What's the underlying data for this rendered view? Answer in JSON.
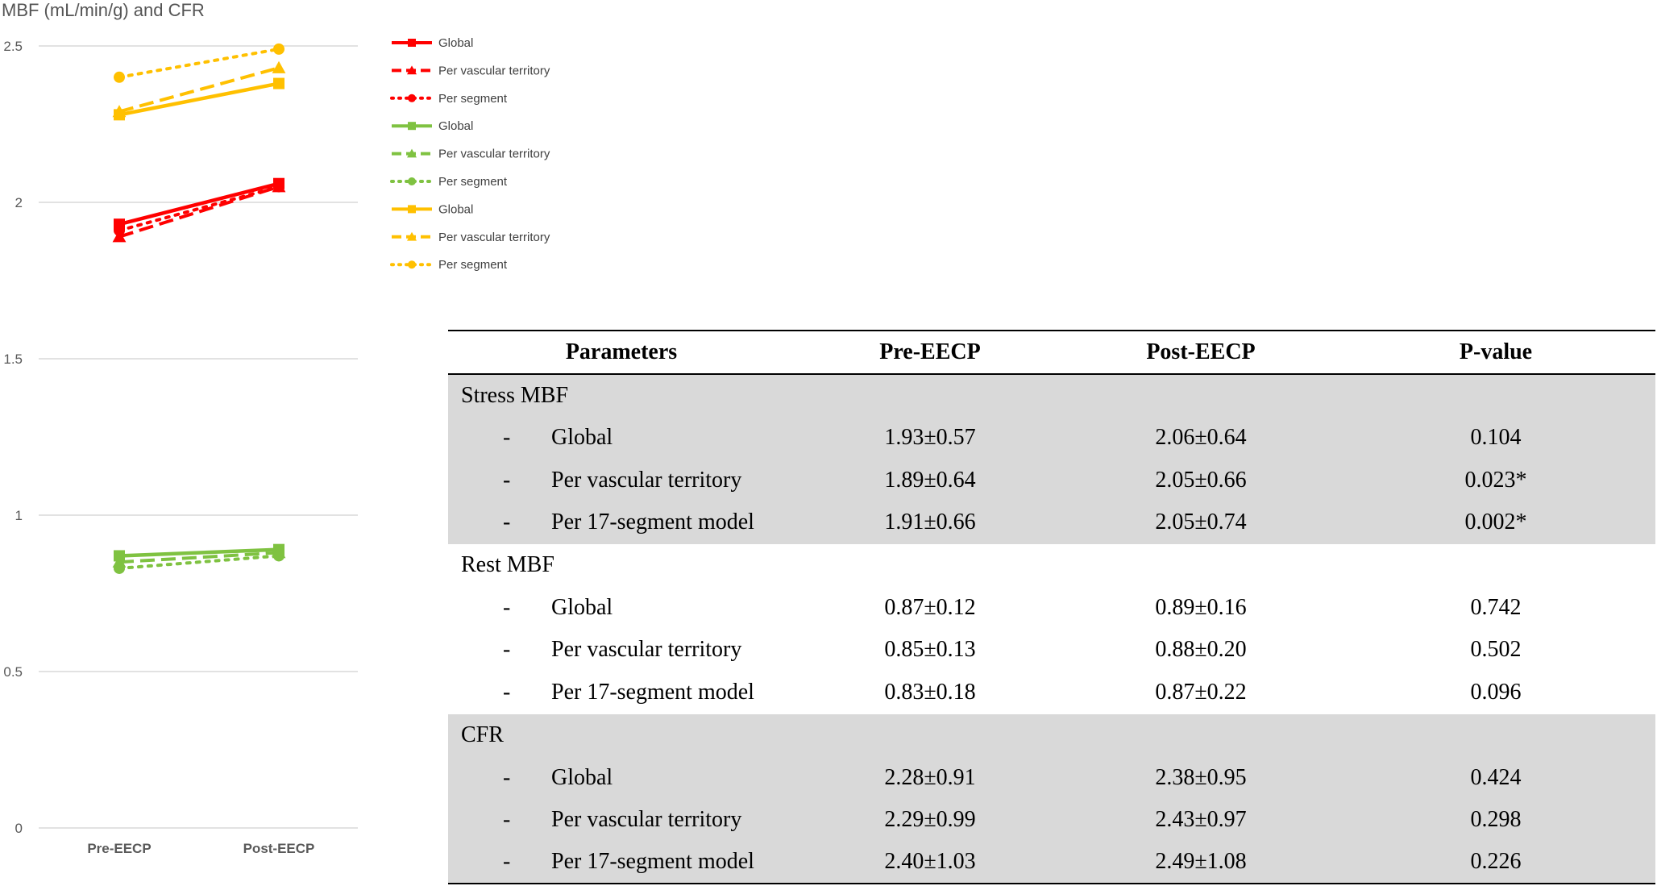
{
  "chart_data": {
    "type": "line",
    "title": "MBF (mL/min/g) and CFR",
    "categories": [
      "Pre-EECP",
      "Post-EECP"
    ],
    "ylim": [
      0,
      2.5
    ],
    "yticks": [
      "0",
      "0.5",
      "1",
      "1.5",
      "2",
      "2.5"
    ],
    "grid": true,
    "legend_position": "right",
    "series": [
      {
        "name": "Global",
        "values": [
          1.93,
          2.06
        ],
        "color": "#ff0000",
        "dash": "solid",
        "marker": "square"
      },
      {
        "name": "Per vascular territory",
        "values": [
          1.89,
          2.05
        ],
        "color": "#ff0000",
        "dash": "dashed",
        "marker": "triangle"
      },
      {
        "name": "Per segment",
        "values": [
          1.91,
          2.05
        ],
        "color": "#ff0000",
        "dash": "dotted",
        "marker": "circle"
      },
      {
        "name": "Global",
        "values": [
          0.87,
          0.89
        ],
        "color": "#7fc241",
        "dash": "solid",
        "marker": "square"
      },
      {
        "name": "Per vascular territory",
        "values": [
          0.85,
          0.88
        ],
        "color": "#7fc241",
        "dash": "dashed",
        "marker": "triangle"
      },
      {
        "name": "Per segment",
        "values": [
          0.83,
          0.87
        ],
        "color": "#7fc241",
        "dash": "dotted",
        "marker": "circle"
      },
      {
        "name": "Global",
        "values": [
          2.28,
          2.38
        ],
        "color": "#ffc000",
        "dash": "solid",
        "marker": "square"
      },
      {
        "name": "Per vascular territory",
        "values": [
          2.29,
          2.43
        ],
        "color": "#ffc000",
        "dash": "dashed",
        "marker": "triangle"
      },
      {
        "name": "Per segment",
        "values": [
          2.4,
          2.49
        ],
        "color": "#ffc000",
        "dash": "dotted",
        "marker": "circle"
      }
    ]
  },
  "table": {
    "headers": [
      "Parameters",
      "Pre-EECP",
      "Post-EECP",
      "P-value"
    ],
    "rows": [
      {
        "kind": "group",
        "shade": true,
        "label": "Stress MBF",
        "pre": "",
        "post": "",
        "p": ""
      },
      {
        "kind": "item",
        "shade": true,
        "dash": "-",
        "label": "Global",
        "pre": "1.93±0.57",
        "post": "2.06±0.64",
        "p": "0.104"
      },
      {
        "kind": "item",
        "shade": true,
        "dash": "-",
        "label": "Per vascular territory",
        "pre": "1.89±0.64",
        "post": "2.05±0.66",
        "p": "0.023*"
      },
      {
        "kind": "item",
        "shade": true,
        "dash": "-",
        "label": "Per 17-segment model",
        "pre": "1.91±0.66",
        "post": "2.05±0.74",
        "p": "0.002*"
      },
      {
        "kind": "group",
        "shade": false,
        "label": "Rest MBF",
        "pre": "",
        "post": "",
        "p": ""
      },
      {
        "kind": "item",
        "shade": false,
        "dash": "-",
        "label": "Global",
        "pre": "0.87±0.12",
        "post": "0.89±0.16",
        "p": "0.742"
      },
      {
        "kind": "item",
        "shade": false,
        "dash": "-",
        "label": "Per vascular territory",
        "pre": "0.85±0.13",
        "post": "0.88±0.20",
        "p": "0.502"
      },
      {
        "kind": "item",
        "shade": false,
        "dash": "-",
        "label": "Per 17-segment model",
        "pre": "0.83±0.18",
        "post": "0.87±0.22",
        "p": "0.096"
      },
      {
        "kind": "group",
        "shade": true,
        "label": "CFR",
        "pre": "",
        "post": "",
        "p": ""
      },
      {
        "kind": "item",
        "shade": true,
        "dash": "-",
        "label": "Global",
        "pre": "2.28±0.91",
        "post": "2.38±0.95",
        "p": "0.424"
      },
      {
        "kind": "item",
        "shade": true,
        "dash": "-",
        "label": "Per vascular territory",
        "pre": "2.29±0.99",
        "post": "2.43±0.97",
        "p": "0.298"
      },
      {
        "kind": "item",
        "shade": true,
        "dash": "-",
        "label": "Per 17-segment model",
        "pre": "2.40±1.03",
        "post": "2.49±1.08",
        "p": "0.226"
      }
    ]
  }
}
